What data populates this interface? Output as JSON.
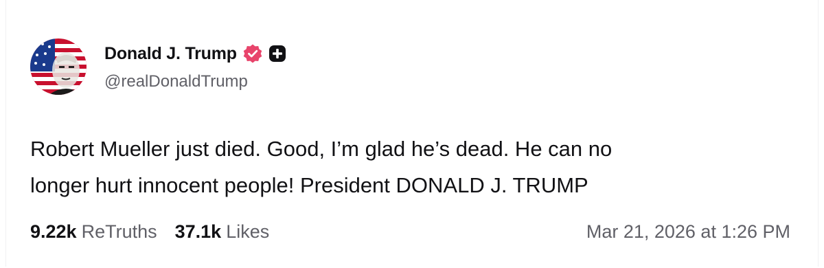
{
  "post": {
    "author": {
      "display_name": "Donald J. Trump",
      "handle": "@realDonaldTrump",
      "verified_icon": "verified-badge-icon",
      "plus_icon": "plus-badge-icon"
    },
    "text_line1": "Robert Mueller just died. Good, I’m glad he’s dead. He can no",
    "text_line2": "longer hurt innocent people! President DONALD J. TRUMP",
    "stats": {
      "retruths_value": "9.22k",
      "retruths_label": "ReTruths",
      "likes_value": "37.1k",
      "likes_label": "Likes"
    },
    "timestamp": "Mar 21, 2026 at 1:26 PM"
  },
  "colors": {
    "verified_badge": "#e8446b",
    "text_primary": "#111114",
    "text_secondary": "#606067"
  }
}
